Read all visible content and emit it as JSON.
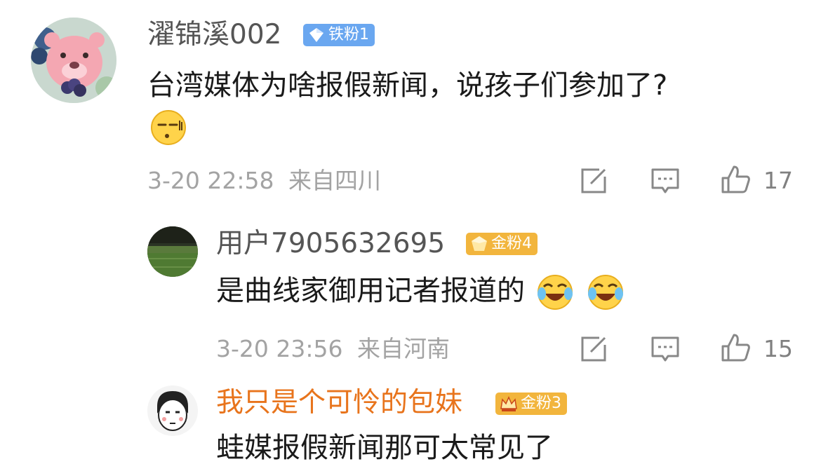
{
  "comments": [
    {
      "username": "濯锦溪002",
      "badge": "铁粉1",
      "badge_color": "#6aa7f0",
      "text": "台湾媒体为啥报假新闻，说孩子们参加了?",
      "emoji": "speechless-face-icon",
      "time": "3-20 22:58",
      "location": "来自四川",
      "likes": "17"
    },
    {
      "username": "用户7905632695",
      "badge": "金粉4",
      "badge_color": "#f2b53d",
      "text": "是曲线家御用记者报道的",
      "emoji": "laughing-crying-face-icon",
      "time": "3-20 23:56",
      "location": "来自河南",
      "likes": "15"
    },
    {
      "username": "我只是个可怜的包妹",
      "username_color": "#e8741c",
      "badge": "金粉3",
      "badge_color": "#f2b53d",
      "text": "蛙媒报假新闻那可太常见了"
    }
  ]
}
